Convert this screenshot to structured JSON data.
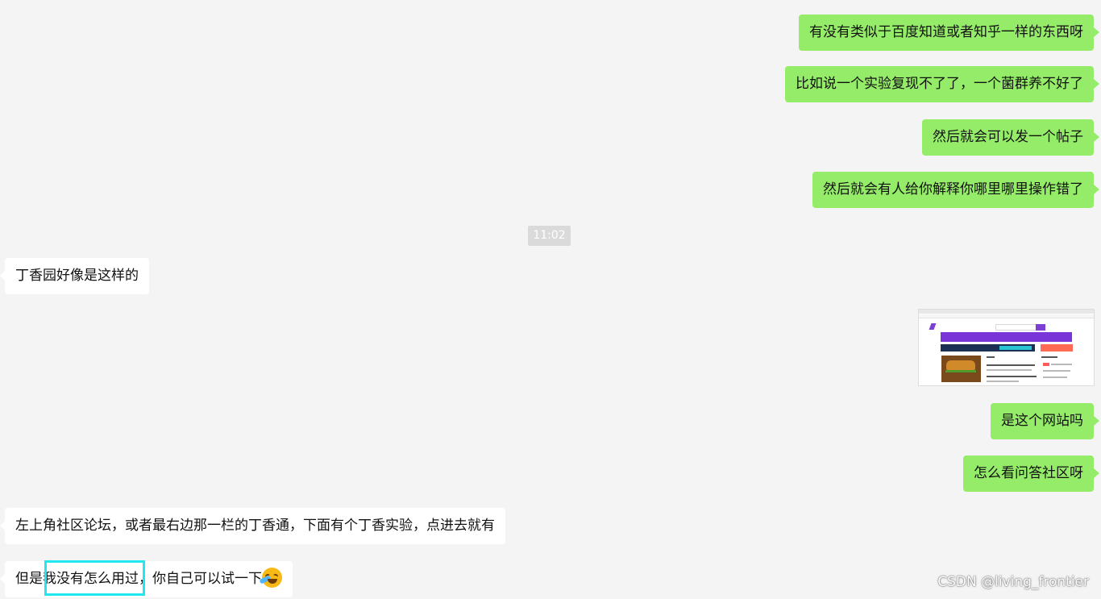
{
  "messages": {
    "m1": "有没有类似于百度知道或者知乎一样的东西呀",
    "m2": "比如说一个实验复现不了了，一个菌群养不好了",
    "m3": "然后就会可以发一个帖子",
    "m4": "然后就会有人给你解释你哪里哪里操作错了",
    "time": "11:02",
    "m5": "丁香园好像是这样的",
    "m6": "是这个网站吗",
    "m7": "怎么看问答社区呀",
    "m8": "左上角社区论坛，或者最右边那一栏的丁香通，下面有个丁香实验，点进去就有",
    "m9_part1": "但是",
    "m9_part2": "我没有怎么用过",
    "m9_part3": "，你自己可以试一下"
  },
  "icons": {
    "thumbnail": "website-screenshot-thumbnail",
    "emoji": "laughing-crying-emoji-icon"
  },
  "colors": {
    "background": "#f4f4f4",
    "sent_bubble": "#95ec69",
    "received_bubble": "#ffffff",
    "highlight_border": "#21e8ef"
  },
  "watermark": "CSDN @living_frontier"
}
